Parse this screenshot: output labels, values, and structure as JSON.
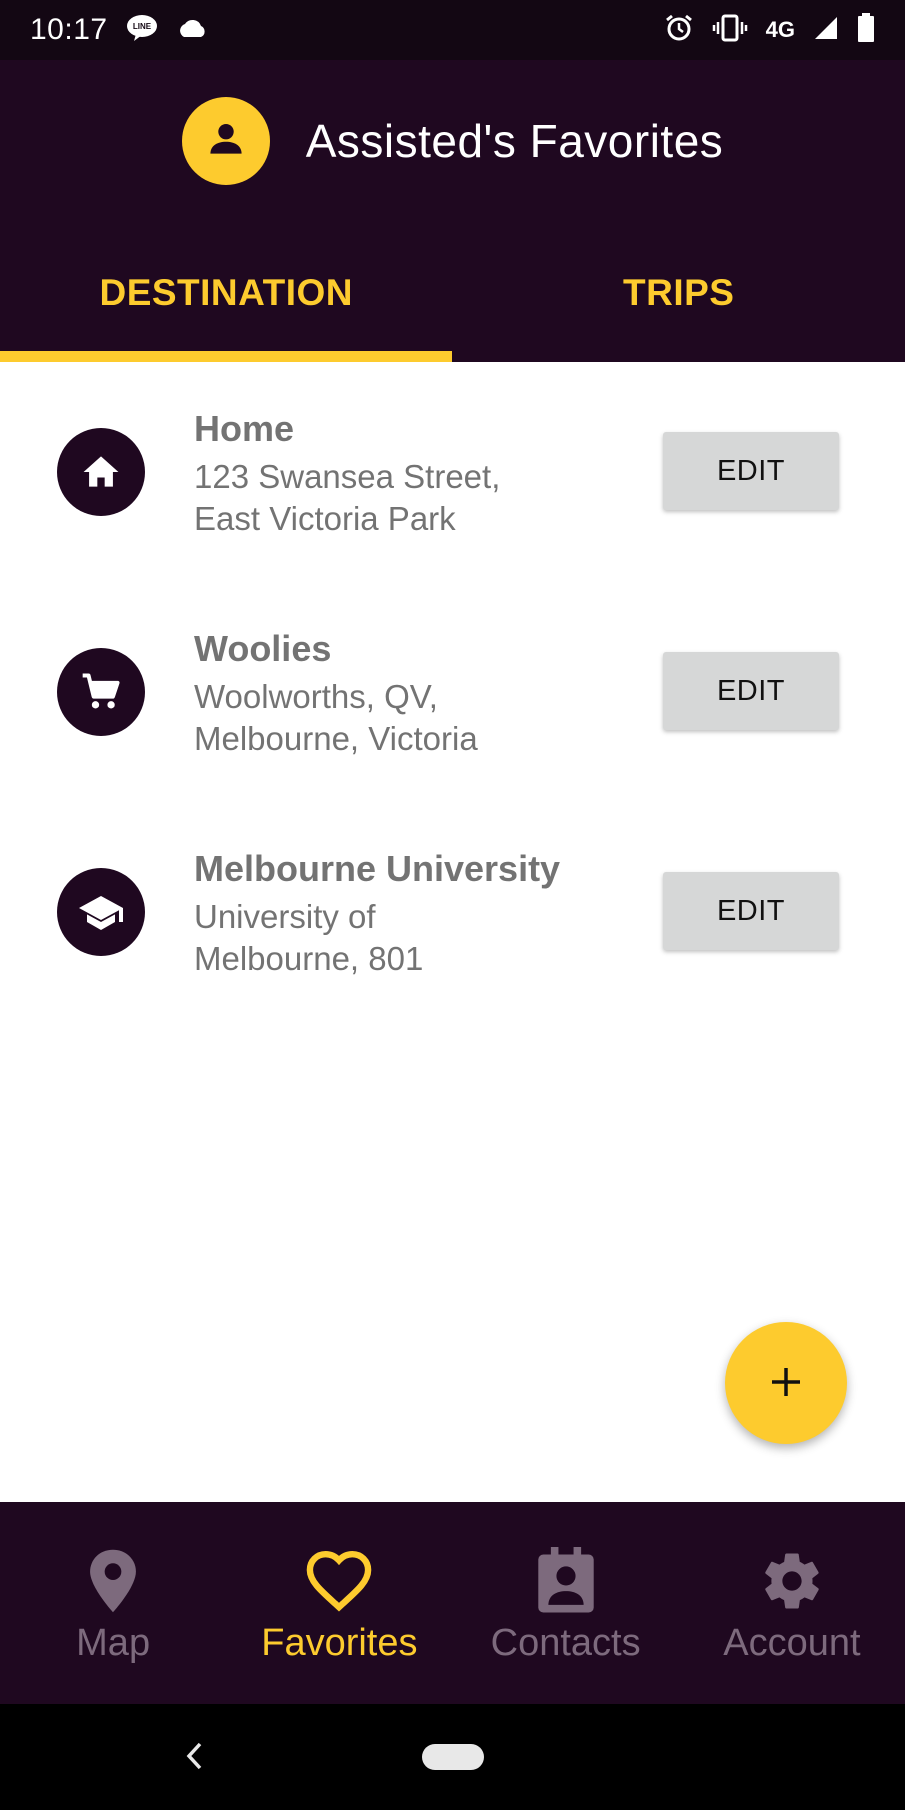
{
  "status_bar": {
    "time": "10:17",
    "network": "4G",
    "icons": [
      "line-app-icon",
      "cloud-icon",
      "alarm-icon",
      "vibrate-icon",
      "signal-icon",
      "battery-icon"
    ]
  },
  "header": {
    "title": "Assisted's Favorites",
    "avatar_icon": "person-icon"
  },
  "tabs": [
    {
      "label": "DESTINATION",
      "active": true
    },
    {
      "label": "TRIPS",
      "active": false
    }
  ],
  "destinations": [
    {
      "name": "Home",
      "address_line1": "123 Swansea Street,",
      "address_line2": "East Victoria Park",
      "icon": "home-icon",
      "button_label": "EDIT"
    },
    {
      "name": "Woolies",
      "address_line1": "Woolworths, QV,",
      "address_line2": "Melbourne, Victoria",
      "icon": "cart-icon",
      "button_label": "EDIT"
    },
    {
      "name": "Melbourne University",
      "address_line1": "University of",
      "address_line2": "Melbourne, 801",
      "icon": "graduation-cap-icon",
      "button_label": "EDIT"
    }
  ],
  "fab": {
    "icon": "plus-icon"
  },
  "bottom_nav": [
    {
      "label": "Map",
      "icon": "location-pin-icon",
      "active": false
    },
    {
      "label": "Favorites",
      "icon": "heart-icon",
      "active": true
    },
    {
      "label": "Contacts",
      "icon": "contacts-icon",
      "active": false
    },
    {
      "label": "Account",
      "icon": "gear-icon",
      "active": false
    }
  ],
  "colors": {
    "header_bg": "#1f0820",
    "status_bar_bg": "#130713",
    "accent": "#fdcb2e",
    "inactive_nav": "#7d6a7d",
    "text_gray": "#737373",
    "button_bg": "#d6d7d7"
  }
}
